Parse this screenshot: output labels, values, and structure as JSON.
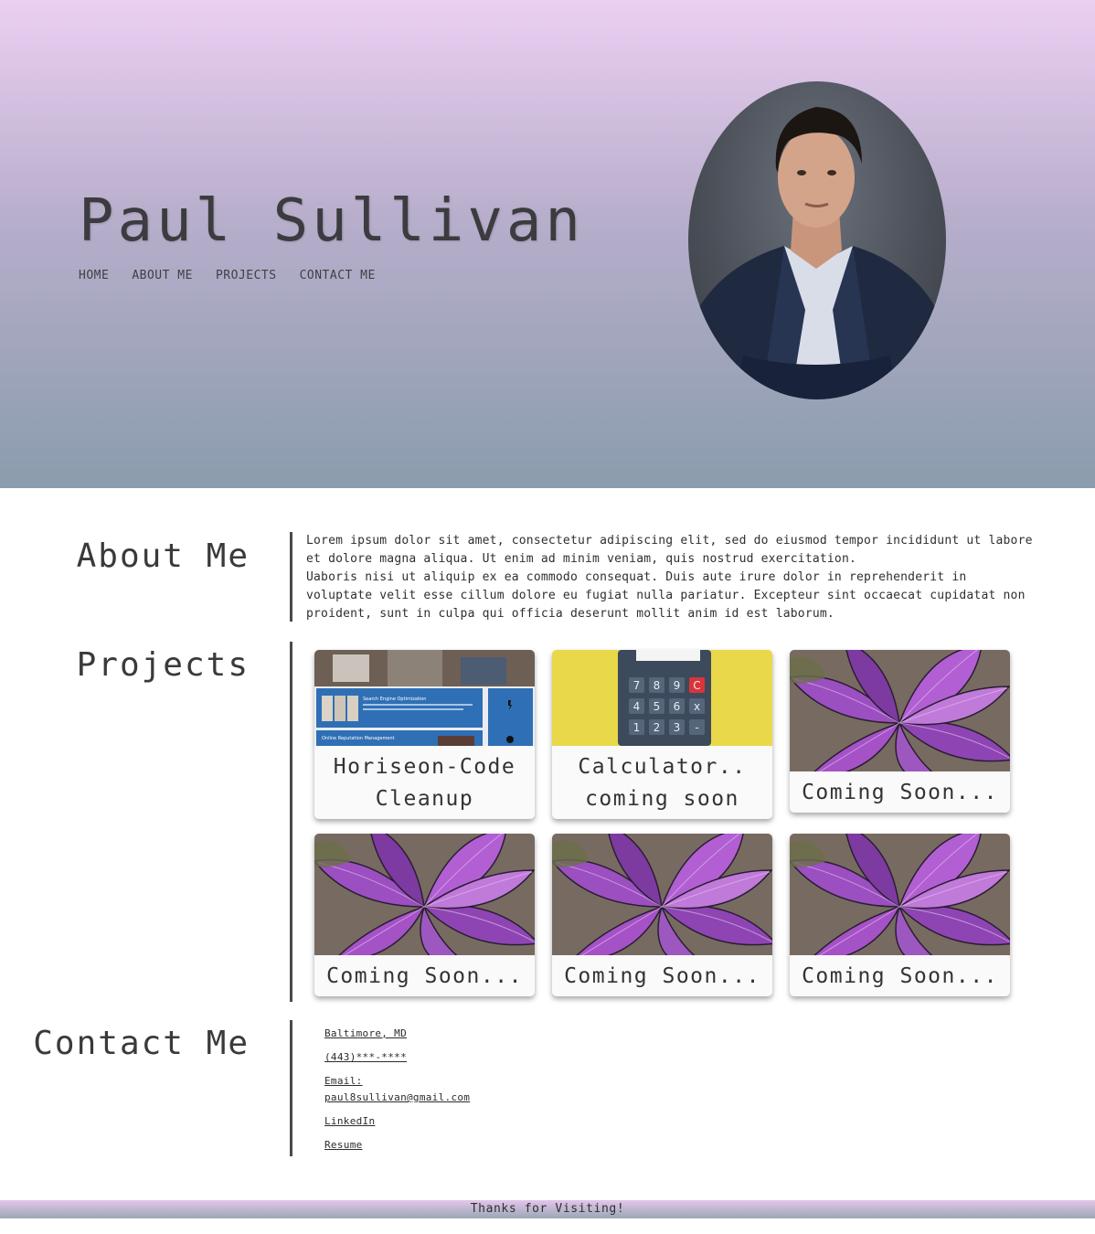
{
  "header": {
    "name": "Paul Sullivan",
    "nav": [
      "HOME",
      "ABOUT ME",
      "PROJECTS",
      "CONTACT ME"
    ]
  },
  "about": {
    "heading": "About Me",
    "paragraph_1": "Lorem ipsum dolor sit amet, consectetur adipiscing elit, sed do eiusmod tempor incididunt ut labore et dolore magna aliqua. Ut enim ad minim veniam, quis nostrud exercitation.",
    "paragraph_2": "Uaboris nisi ut aliquip ex ea commodo consequat. Duis aute irure dolor in reprehenderit in voluptate velit esse cillum dolore eu fugiat nulla pariatur. Excepteur sint occaecat cupidatat non proident, sunt in culpa qui officia deserunt mollit anim id est laborum."
  },
  "projects": {
    "heading": "Projects",
    "cards": [
      {
        "title": "Horiseon-Code Cleanup",
        "image": "website-screenshot"
      },
      {
        "title": "Calculator.. coming soon",
        "image": "calculator-photo"
      },
      {
        "title": "Coming Soon...",
        "image": "purple-plant-photo"
      },
      {
        "title": "Coming Soon...",
        "image": "purple-plant-photo"
      },
      {
        "title": "Coming Soon...",
        "image": "purple-plant-photo"
      },
      {
        "title": "Coming Soon...",
        "image": "purple-plant-photo"
      }
    ],
    "screenshot_text": {
      "seo": "Search Engine Optimization",
      "orm": "Online Reputation Management"
    },
    "calculator_keys": [
      "7",
      "8",
      "9",
      "C",
      "4",
      "5",
      "6",
      "x",
      "1",
      "2",
      "3",
      "-"
    ]
  },
  "contact": {
    "heading": "Contact Me",
    "location": "Baltimore, MD",
    "phone": "(443)***-****",
    "email_label": "Email:",
    "email": "paul8sullivan@gmail.com",
    "linkedin": "LinkedIn",
    "resume": "Resume"
  },
  "footer": {
    "text": "Thanks for Visiting!"
  },
  "colors": {
    "header_top": "#eccff2",
    "header_bottom": "#8a9cad",
    "text": "#3a3a3a",
    "divider": "#4b4b4b"
  }
}
